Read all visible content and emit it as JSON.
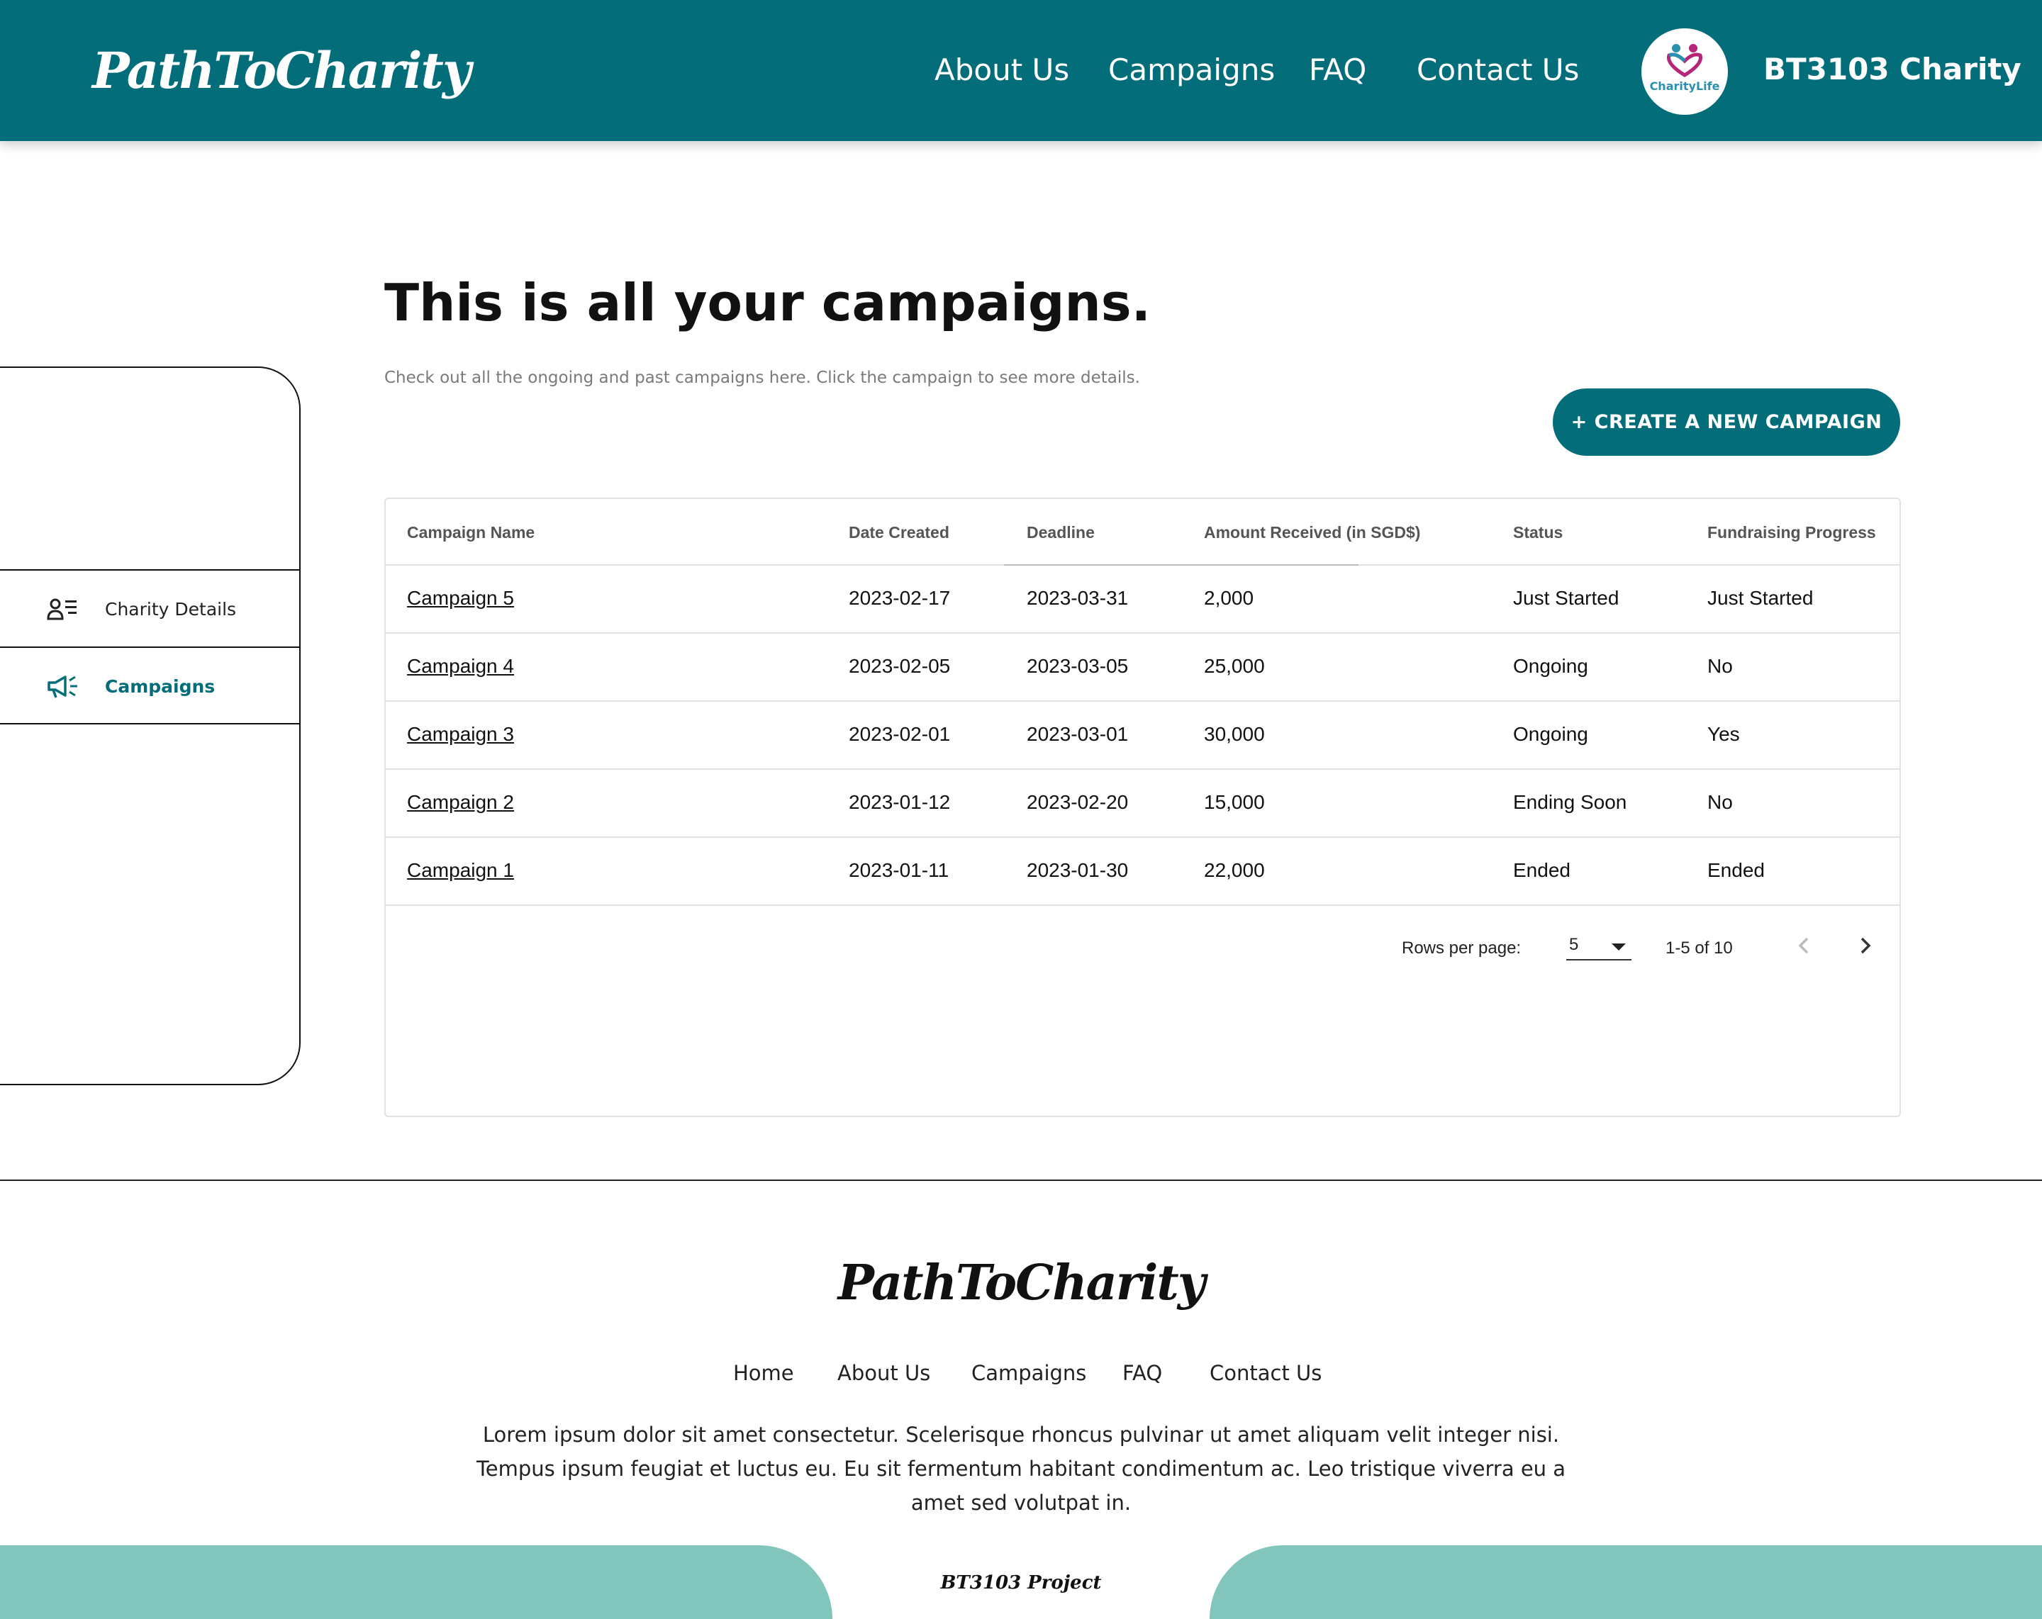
{
  "header": {
    "brand": "PathToCharity",
    "nav": [
      "About Us",
      "Campaigns",
      "FAQ",
      "Contact Us"
    ],
    "avatar_logo_text": "CharityLife",
    "org_name": "BT3103 Charity"
  },
  "sidebar": {
    "items": [
      {
        "label": "Charity Details",
        "icon": "person-list-icon",
        "active": false
      },
      {
        "label": "Campaigns",
        "icon": "megaphone-icon",
        "active": true
      }
    ]
  },
  "main": {
    "title": "This is all your campaigns.",
    "subtitle": "Check out all the ongoing and past campaigns here. Click the campaign to see more details.",
    "create_button": "+ CREATE A NEW CAMPAIGN"
  },
  "table": {
    "columns": [
      "Campaign Name",
      "Date Created",
      "Deadline",
      "Amount Received (in SGD$)",
      "Status",
      "Fundraising Progress"
    ],
    "rows": [
      [
        "Campaign 5",
        "2023-02-17",
        "2023-03-31",
        "2,000",
        "Just Started",
        "Just Started"
      ],
      [
        "Campaign 4",
        "2023-02-05",
        "2023-03-05",
        "25,000",
        "Ongoing",
        "No"
      ],
      [
        "Campaign 3",
        "2023-02-01",
        "2023-03-01",
        "30,000",
        "Ongoing",
        "Yes"
      ],
      [
        "Campaign 2",
        "2023-01-12",
        "2023-02-20",
        "15,000",
        "Ending Soon",
        "No"
      ],
      [
        "Campaign 1",
        "2023-01-11",
        "2023-01-30",
        "22,000",
        "Ended",
        "Ended"
      ]
    ],
    "pagination": {
      "rows_per_page_label": "Rows per page:",
      "rows_per_page": "5",
      "range": "1-5 of 10"
    }
  },
  "footer": {
    "brand": "PathToCharity",
    "nav": [
      "Home",
      "About Us",
      "Campaigns",
      "FAQ",
      "Contact Us"
    ],
    "text": "Lorem ipsum dolor sit amet consectetur. Scelerisque rhoncus pulvinar ut amet aliquam velit integer nisi. Tempus ipsum feugiat et luctus eu. Eu sit fermentum habitant condimentum ac. Leo tristique viverra eu a amet sed volutpat in.",
    "credit": "BT3103 Project"
  },
  "colors": {
    "primary": "#036e7a",
    "footer_accent": "#82c5bd"
  }
}
